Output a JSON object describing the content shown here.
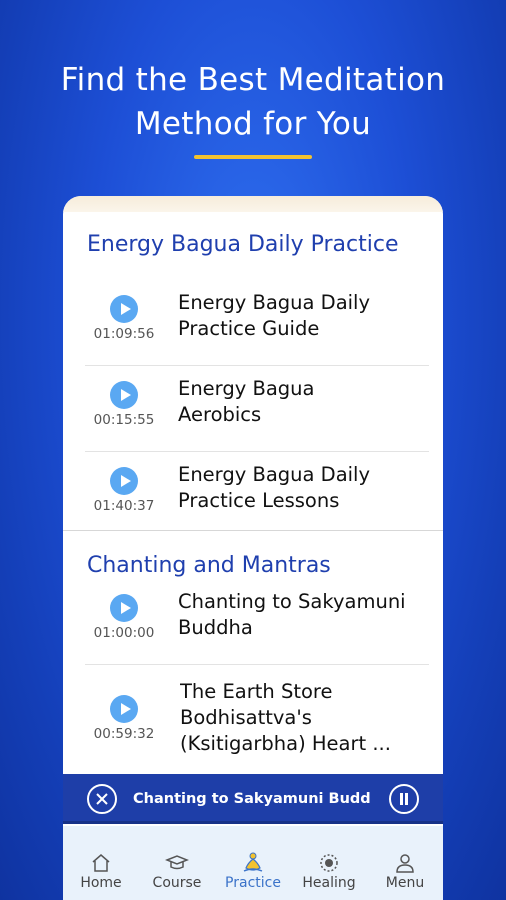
{
  "header": {
    "line1": "Find the Best Meditation",
    "line2": "Method for You"
  },
  "sections": [
    {
      "title": "Energy Bagua Daily Practice",
      "items": [
        {
          "duration": "01:09:56",
          "title": "Energy Bagua Daily Practice Guide"
        },
        {
          "duration": "00:15:55",
          "title": "Energy Bagua Aerobics"
        },
        {
          "duration": "01:40:37",
          "title": "Energy Bagua Daily Practice Lessons"
        }
      ]
    },
    {
      "title": "Chanting and Mantras",
      "items": [
        {
          "duration": "01:00:00",
          "title": "Chanting to Sakyamuni Buddha"
        },
        {
          "duration": "00:59:32",
          "title": "The Earth Store Bodhisattva's (Ksitigarbha) Heart ..."
        }
      ]
    }
  ],
  "now_playing": {
    "title": "Chanting to Sakyamuni Budd"
  },
  "tabs": [
    {
      "label": "Home",
      "icon": "home-icon"
    },
    {
      "label": "Course",
      "icon": "graduation-cap-icon"
    },
    {
      "label": "Practice",
      "icon": "meditation-icon",
      "active": true
    },
    {
      "label": "Healing",
      "icon": "healing-icon"
    },
    {
      "label": "Menu",
      "icon": "person-icon"
    }
  ],
  "colors": {
    "accent": "#1f3fae",
    "play_button": "#5aa8f2",
    "highlight": "#f2c230",
    "active_tab": "#3b73c9"
  }
}
